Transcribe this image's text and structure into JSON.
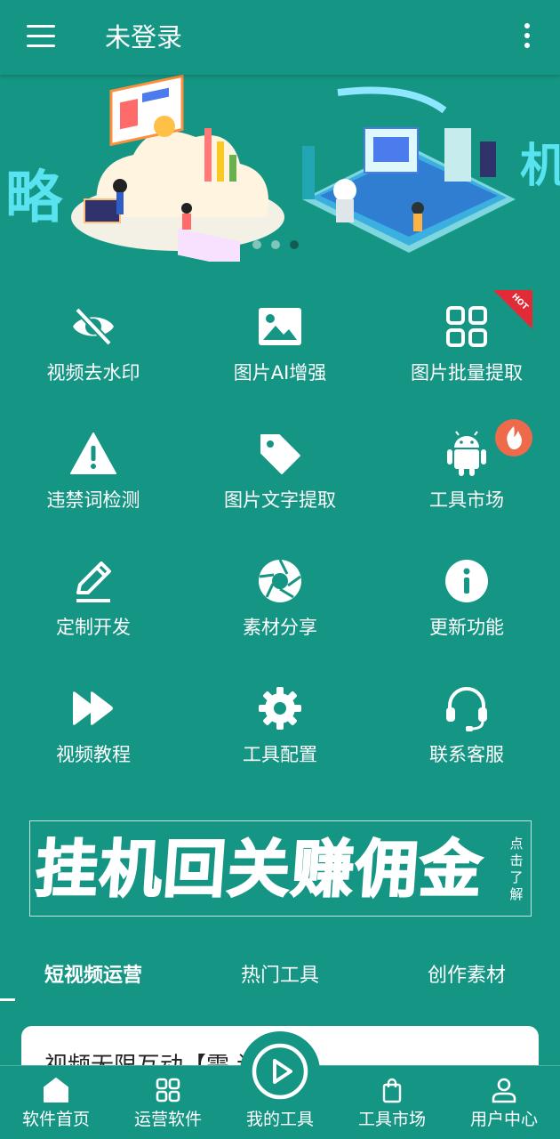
{
  "appbar": {
    "title": "未登录"
  },
  "grid": {
    "items": [
      {
        "label": "视频去水印"
      },
      {
        "label": "图片AI增强"
      },
      {
        "label": "图片批量提取"
      },
      {
        "label": "违禁词检测"
      },
      {
        "label": "图片文字提取"
      },
      {
        "label": "工具市场"
      },
      {
        "label": "定制开发"
      },
      {
        "label": "素材分享"
      },
      {
        "label": "更新功能"
      },
      {
        "label": "视频教程"
      },
      {
        "label": "工具配置"
      },
      {
        "label": "联系客服"
      }
    ],
    "hot_badge": "HOT"
  },
  "banner": {
    "left_fragment": "略",
    "right_fragment": "机",
    "slide_index": 3,
    "slide_count": 3
  },
  "promo": {
    "text": "挂机回关赚佣金",
    "side": "点击了解"
  },
  "tabs": [
    {
      "label": "短视频运营",
      "active": true
    },
    {
      "label": "热门工具",
      "active": false
    },
    {
      "label": "创作素材",
      "active": false
    }
  ],
  "card": {
    "title": "视频无限互动【需    设以上】"
  },
  "bottom_nav": [
    {
      "label": "软件首页",
      "icon": "home-icon"
    },
    {
      "label": "运营软件",
      "icon": "grid-icon"
    },
    {
      "label": "我的工具",
      "icon": "play-circle-icon"
    },
    {
      "label": "工具市场",
      "icon": "shopping-bag-icon"
    },
    {
      "label": "用户中心",
      "icon": "user-icon"
    }
  ],
  "colors": {
    "primary": "#159584",
    "hot": "#e32a37",
    "fire": "#ef6a4a",
    "card": "#ffffff"
  }
}
